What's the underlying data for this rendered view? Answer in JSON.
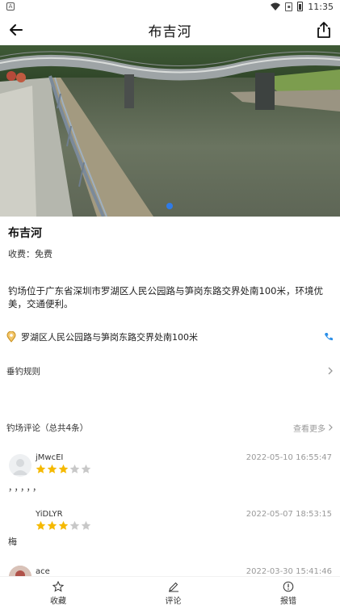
{
  "status_bar": {
    "time": "11:35",
    "left_badge": "A",
    "icons": [
      "wifi-icon",
      "sim-icon",
      "battery-icon"
    ]
  },
  "header": {
    "title": "布吉河",
    "back_icon": "back-arrow-icon",
    "share_icon": "share-icon"
  },
  "gallery": {
    "active_dot_color": "#2f7be8"
  },
  "spot": {
    "name": "布吉河",
    "fee": "收费：免费",
    "description": "钓场位于广东省深圳市罗湖区人民公园路与笋岗东路交界处南100米，环境优美，交通便利。",
    "address": "罗湖区人民公园路与笋岗东路交界处南100米",
    "address_icon": "location-pin-icon",
    "phone_icon": "phone-icon"
  },
  "rules": {
    "label": "垂钓规则"
  },
  "comments": {
    "header": "钓场评论（总共4条）",
    "more": "查看更多",
    "star_color": "#f5b900",
    "items": [
      {
        "user": "jMwcEI",
        "time": "2022-05-10 16:55:47",
        "rating": 3,
        "body": "，，，，，",
        "avatar": "default-avatar"
      },
      {
        "user": "YiDLYR",
        "time": "2022-05-07 18:53:15",
        "rating": 3,
        "body": "梅",
        "avatar": "none"
      },
      {
        "user": "ace",
        "time": "2022-03-30 15:41:46",
        "rating": null,
        "body": "",
        "avatar": "photo-avatar"
      }
    ]
  },
  "bottom_bar": {
    "tabs": [
      {
        "label": "收藏",
        "icon": "star-outline-icon"
      },
      {
        "label": "评论",
        "icon": "edit-icon"
      },
      {
        "label": "报错",
        "icon": "alert-circle-icon"
      }
    ]
  }
}
